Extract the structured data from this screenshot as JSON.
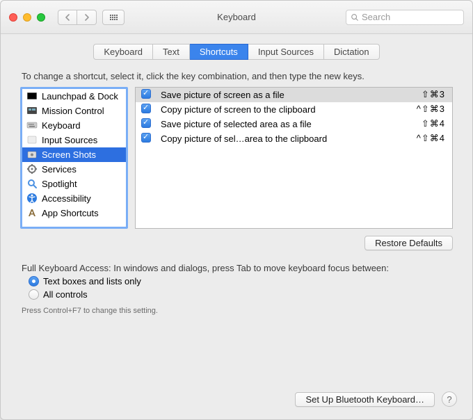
{
  "window": {
    "title": "Keyboard"
  },
  "toolbar": {
    "search_placeholder": "Search"
  },
  "tabs": {
    "items": [
      "Keyboard",
      "Text",
      "Shortcuts",
      "Input Sources",
      "Dictation"
    ],
    "active_index": 2
  },
  "hint": "To change a shortcut, select it, click the key combination, and then type the new keys.",
  "sidebar": {
    "items": [
      {
        "label": "Launchpad & Dock",
        "icon": "launchpad"
      },
      {
        "label": "Mission Control",
        "icon": "mission"
      },
      {
        "label": "Keyboard",
        "icon": "keyboard"
      },
      {
        "label": "Input Sources",
        "icon": "input"
      },
      {
        "label": "Screen Shots",
        "icon": "screenshot"
      },
      {
        "label": "Services",
        "icon": "services"
      },
      {
        "label": "Spotlight",
        "icon": "spotlight"
      },
      {
        "label": "Accessibility",
        "icon": "accessibility"
      },
      {
        "label": "App Shortcuts",
        "icon": "app"
      }
    ],
    "selected_index": 4
  },
  "shortcuts": {
    "items": [
      {
        "checked": true,
        "label": "Save picture of screen as a file",
        "keys": "⇧⌘3"
      },
      {
        "checked": true,
        "label": "Copy picture of screen to the clipboard",
        "keys": "^⇧⌘3"
      },
      {
        "checked": true,
        "label": "Save picture of selected area as a file",
        "keys": "⇧⌘4"
      },
      {
        "checked": true,
        "label": "Copy picture of sel…area to the clipboard",
        "keys": "^⇧⌘4"
      }
    ],
    "selected_index": 0
  },
  "restore_label": "Restore Defaults",
  "full_keyboard_access": {
    "label": "Full Keyboard Access: In windows and dialogs, press Tab to move keyboard focus between:",
    "options": [
      "Text boxes and lists only",
      "All controls"
    ],
    "selected_index": 0,
    "hint": "Press Control+F7 to change this setting."
  },
  "bluetooth_button": "Set Up Bluetooth Keyboard…"
}
